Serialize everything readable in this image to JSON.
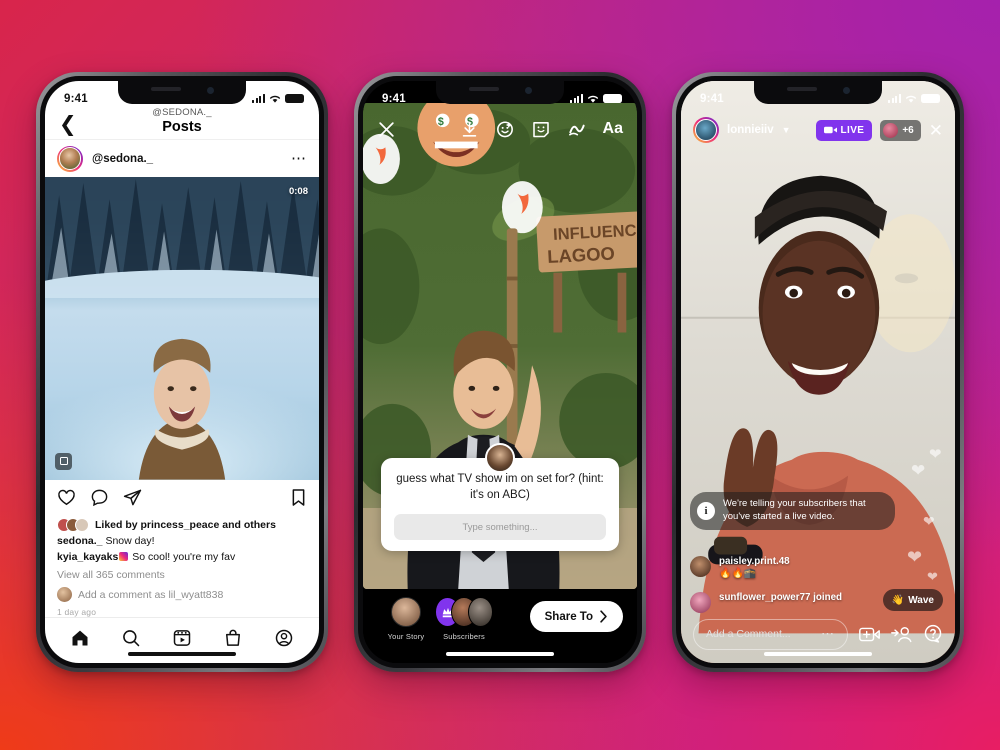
{
  "background": {
    "gradient_colors": [
      "#ef3b18",
      "#d8254b",
      "#c62a79",
      "#a521ad",
      "#e81e63"
    ]
  },
  "phones": [
    {
      "id": "phone-feed",
      "statusbar": {
        "time": "9:41",
        "signal_icon": "cellular-bars-icon",
        "wifi_icon": "wifi-icon",
        "battery_icon": "battery-icon"
      },
      "nav": {
        "back_icon": "chevron-left-icon",
        "subtitle": "@SEDONA._",
        "title": "Posts"
      },
      "post": {
        "avatar": "user-avatar",
        "username": "@sedona._",
        "more_icon": "more-options-icon",
        "duration": "0:08",
        "tag_icon": "tagged-users-icon",
        "actions": {
          "like_icon": "heart-icon",
          "comment_icon": "comment-bubble-icon",
          "share_icon": "share-paper-plane-icon",
          "save_icon": "bookmark-icon"
        },
        "liked_by": "Liked by princess_peace and others",
        "caption_user": "sedona._",
        "caption_text": "Snow day!",
        "comment_user": "kyia_kayaks",
        "comment_text": "So cool! you're my fav",
        "view_all": "View all 365 comments",
        "add_comment": "Add a comment as lil_wyatt838",
        "timestamp": "1 day ago"
      },
      "tabbar": [
        {
          "name": "home-tab",
          "icon": "home-icon"
        },
        {
          "name": "search-tab",
          "icon": "search-icon"
        },
        {
          "name": "reels-tab",
          "icon": "reels-icon"
        },
        {
          "name": "shop-tab",
          "icon": "shopping-bag-icon"
        },
        {
          "name": "profile-tab",
          "icon": "profile-circle-icon"
        }
      ]
    },
    {
      "id": "phone-story-composer",
      "statusbar": {
        "time": "9:41"
      },
      "tools": [
        {
          "name": "close-story-button",
          "icon": "close-x-icon"
        },
        {
          "name": "save-story-button",
          "icon": "download-icon"
        },
        {
          "name": "effects-button",
          "icon": "smiley-face-icon"
        },
        {
          "name": "sticker-button",
          "icon": "sticker-square-icon"
        },
        {
          "name": "draw-button",
          "icon": "squiggle-draw-icon"
        },
        {
          "name": "text-button",
          "icon": "text-aa-icon",
          "label": "Aa"
        }
      ],
      "question_sticker": {
        "avatar": "question-author-avatar",
        "question": "guess what TV show im on set for? (hint: it's on ABC)",
        "input_placeholder": "Type something..."
      },
      "bottom": {
        "your_story_label": "Your Story",
        "subscribers_label": "Subscribers",
        "subscribers_badge_icon": "subscriber-crown-icon",
        "share_to_label": "Share To",
        "share_to_icon": "chevron-right-icon"
      }
    },
    {
      "id": "phone-live",
      "statusbar": {
        "time": "9:41"
      },
      "header": {
        "avatar": "broadcaster-avatar",
        "username": "lonnieiiv",
        "dropdown_icon": "chevron-down-icon",
        "live_badge": "LIVE",
        "live_badge_icon": "live-video-icon",
        "viewers_count": "+6",
        "viewer_avatar": "viewer-avatar",
        "close_icon": "close-x-icon"
      },
      "system_message": {
        "icon": "info-circle-icon",
        "text": "We're telling your subscribers that you've started a live video."
      },
      "comments": [
        {
          "avatar": "commenter-avatar-1",
          "username": "paisley.print.48",
          "text": "🔥🔥🕋"
        },
        {
          "avatar": "commenter-avatar-2",
          "username": "sunflower_power77 joined",
          "text": ""
        }
      ],
      "wave_button": {
        "label": "Wave",
        "icon": "waving-hand-icon"
      },
      "bottom": {
        "comment_placeholder": "Add a Comment...",
        "comment_more_icon": "more-dots-icon",
        "add_video_icon": "add-video-camera-icon",
        "add_person_icon": "add-person-icon",
        "help_icon": "question-help-icon"
      }
    }
  ]
}
